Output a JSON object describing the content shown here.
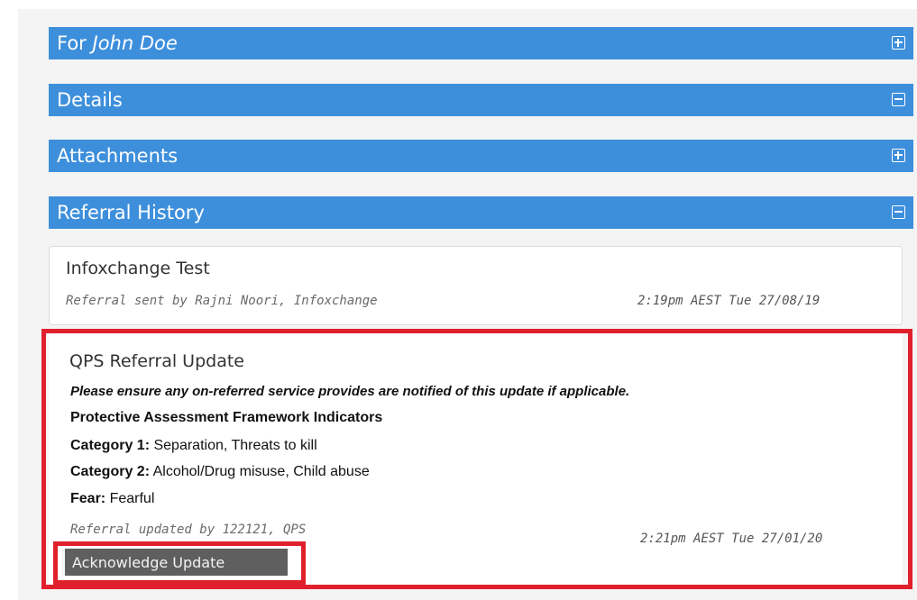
{
  "sections": {
    "for_prefix": "For",
    "for_name": "John Doe",
    "details": "Details",
    "attachments": "Attachments",
    "referral_history": "Referral History"
  },
  "history": {
    "item1": {
      "title": "Infoxchange Test",
      "meta": "Referral sent by Rajni Noori, Infoxchange",
      "time": "2:19pm AEST Tue 27/08/19"
    },
    "item2": {
      "title": "QPS Referral Update",
      "notice": "Please ensure any on-referred service provides are notified of this update if applicable.",
      "framework_heading": "Protective Assessment Framework Indicators",
      "cat1_label": "Category 1:",
      "cat1_value": "Separation, Threats to kill",
      "cat2_label": "Category 2:",
      "cat2_value": "Alcohol/Drug misuse, Child abuse",
      "fear_label": "Fear:",
      "fear_value": "Fearful",
      "meta": "Referral updated by  122121, QPS",
      "time": "2:21pm AEST Tue 27/01/20",
      "button": "Acknowledge Update"
    }
  },
  "colors": {
    "section_bar": "#3d8fdc",
    "highlight": "#e0202c",
    "button": "#5f5f5f"
  },
  "icons": {
    "expand": "plus-square-icon",
    "collapse": "minus-square-icon"
  }
}
